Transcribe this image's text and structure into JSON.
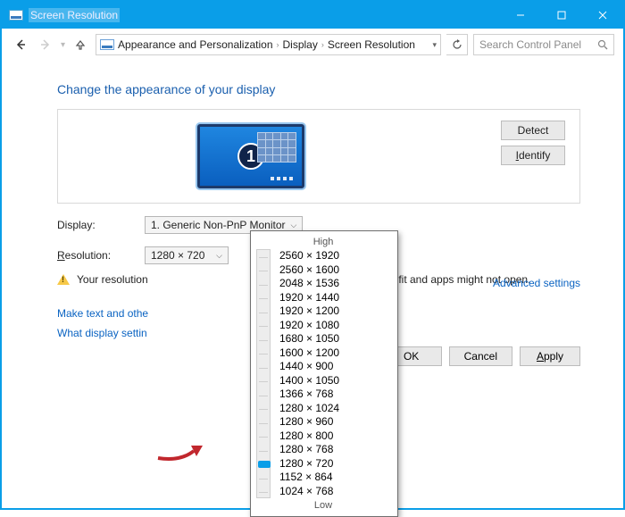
{
  "titlebar": {
    "title": "Screen Resolution"
  },
  "win": {
    "min": "—",
    "max": "☐",
    "close": "✕"
  },
  "breadcrumb": {
    "items": [
      "Appearance and Personalization",
      "Display",
      "Screen Resolution"
    ]
  },
  "search": {
    "placeholder": "Search Control Panel"
  },
  "heading": "Change the appearance of your display",
  "monitor_number": "1",
  "buttons": {
    "detect": "Detect",
    "identify_u": "I",
    "identify_rest": "dentify"
  },
  "form": {
    "display_label": "Display:",
    "display_value": "1. Generic Non-PnP Monitor",
    "resolution_label_u": "R",
    "resolution_label_rest": "esolution:",
    "resolution_value": "1280 × 720"
  },
  "warning": {
    "pre": "Your resolution",
    "post": "ight not fit and apps might not open."
  },
  "advanced": "Advanced settings",
  "links": {
    "l1": "Make text and othe",
    "l2": "What display settin"
  },
  "footer": {
    "ok": "OK",
    "cancel": "Cancel",
    "apply_u": "A",
    "apply_rest": "pply"
  },
  "dropdown": {
    "high": "High",
    "low": "Low",
    "options": [
      "2560 × 1920",
      "2560 × 1600",
      "2048 × 1536",
      "1920 × 1440",
      "1920 × 1200",
      "1920 × 1080",
      "1680 × 1050",
      "1600 × 1200",
      "1440 × 900",
      "1400 × 1050",
      "1366 × 768",
      "1280 × 1024",
      "1280 × 960",
      "1280 × 800",
      "1280 × 768",
      "1280 × 720",
      "1152 × 864",
      "1024 × 768"
    ],
    "selected_index": 15
  }
}
